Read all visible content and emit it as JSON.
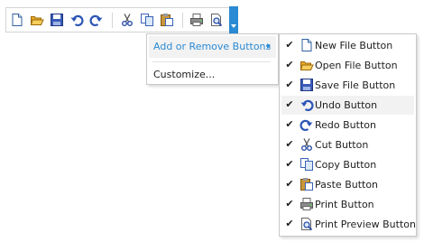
{
  "toolbar": {
    "buttons": [
      {
        "icon": "new-file-icon"
      },
      {
        "icon": "open-file-icon"
      },
      {
        "icon": "save-file-icon"
      },
      {
        "icon": "undo-icon"
      },
      {
        "icon": "redo-icon"
      },
      {
        "icon": "cut-icon"
      },
      {
        "icon": "copy-icon"
      },
      {
        "icon": "paste-icon"
      },
      {
        "icon": "print-icon"
      },
      {
        "icon": "print-preview-icon"
      }
    ],
    "overflow_icon": "chevron-down-icon"
  },
  "menu": {
    "add_remove_label": "Add or Remove Buttons",
    "customize_label": "Customize..."
  },
  "submenu": {
    "check_glyph": "✔",
    "items": [
      {
        "label": "New File Button",
        "checked": true,
        "icon": "new-file-icon"
      },
      {
        "label": "Open File Button",
        "checked": true,
        "icon": "open-file-icon"
      },
      {
        "label": "Save File Button",
        "checked": true,
        "icon": "save-file-icon"
      },
      {
        "label": "Undo Button",
        "checked": true,
        "icon": "undo-icon",
        "highlighted": true
      },
      {
        "label": "Redo Button",
        "checked": true,
        "icon": "redo-icon"
      },
      {
        "label": "Cut Button",
        "checked": true,
        "icon": "cut-icon"
      },
      {
        "label": "Copy Button",
        "checked": true,
        "icon": "copy-icon"
      },
      {
        "label": "Paste Button",
        "checked": true,
        "icon": "paste-icon"
      },
      {
        "label": "Print Button",
        "checked": true,
        "icon": "print-icon"
      },
      {
        "label": "Print Preview Button",
        "checked": true,
        "icon": "print-preview-icon"
      }
    ]
  },
  "colors": {
    "accent": "#2a8ad4",
    "highlight_bg": "#f2f2f2",
    "border": "#c9c9c9"
  }
}
